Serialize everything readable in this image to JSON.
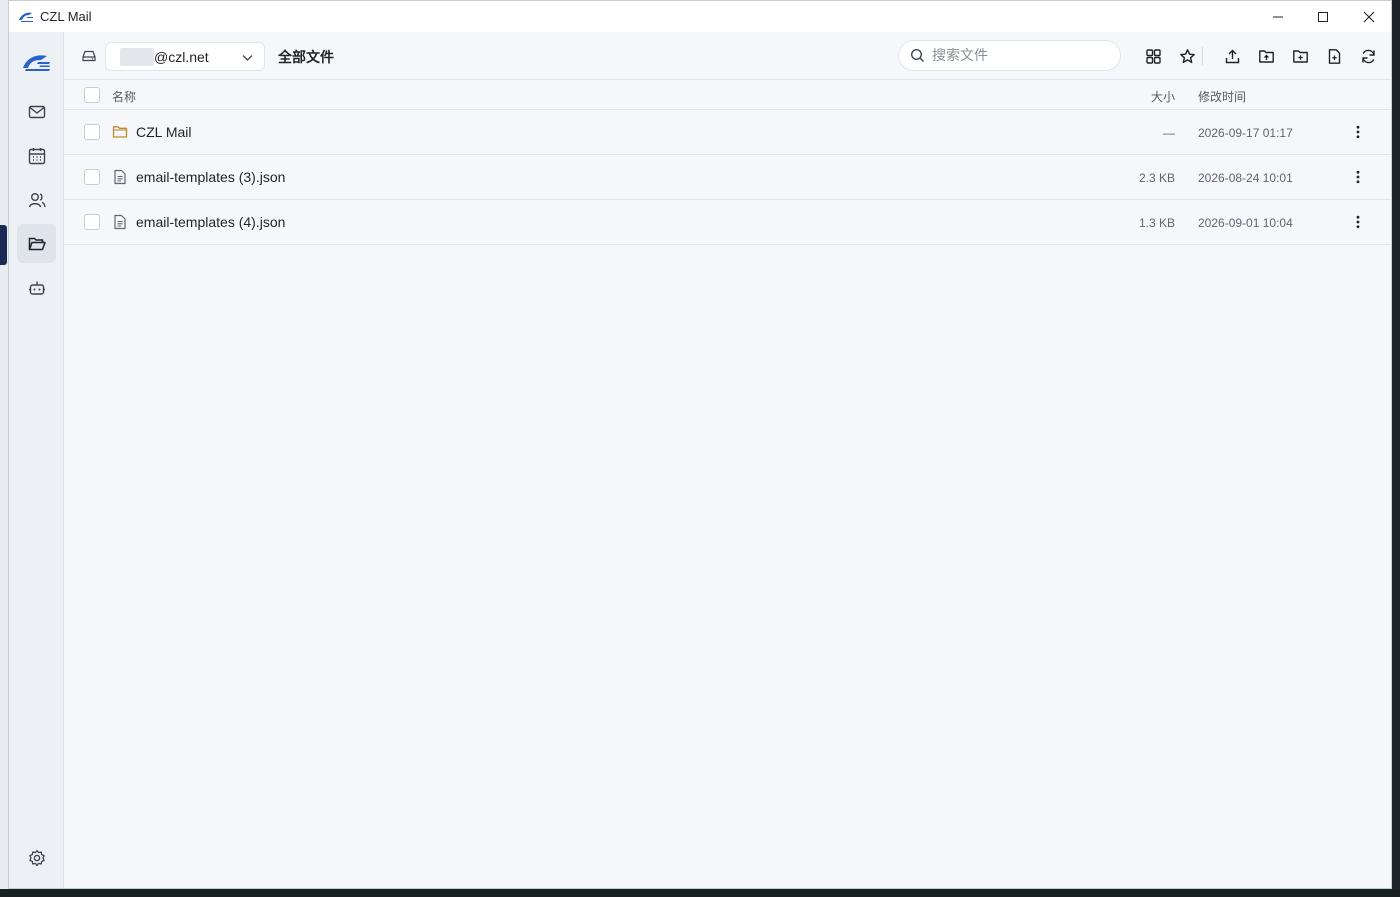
{
  "window": {
    "title": "CZL Mail"
  },
  "toolbar": {
    "account": "@czl.net",
    "breadcrumb": "全部文件",
    "search_placeholder": "搜索文件"
  },
  "columns": {
    "name": "名称",
    "size": "大小",
    "modified": "修改时间"
  },
  "files": [
    {
      "type": "folder",
      "name": "CZL Mail",
      "size": "—",
      "modified": "2026-09-17 01:17"
    },
    {
      "type": "file",
      "name": "email-templates (3).json",
      "size": "2.3 KB",
      "modified": "2026-08-24 10:01"
    },
    {
      "type": "file",
      "name": "email-templates (4).json",
      "size": "1.3 KB",
      "modified": "2026-09-01 10:04"
    }
  ],
  "sidebar": {
    "items": [
      "mail-icon",
      "calendar-icon",
      "contacts-icon",
      "folder-open-icon",
      "robot-icon"
    ],
    "active": "folder-open-icon",
    "settings": "gear-icon"
  },
  "colors": {
    "accent": "#2a62c9",
    "folder": "#c08a2e",
    "text": "#1f2328"
  }
}
